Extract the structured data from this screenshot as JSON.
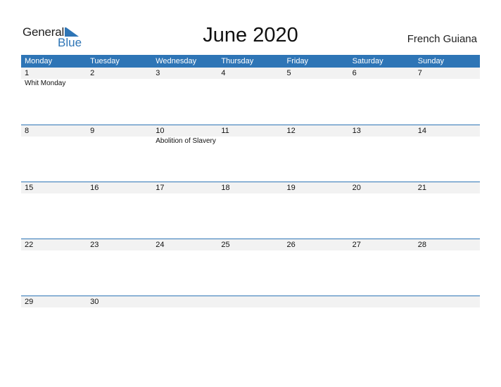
{
  "logo": {
    "line1": "General",
    "line2": "Blue",
    "accent_color": "#2e75b6"
  },
  "title": "June 2020",
  "country": "French Guiana",
  "weekdays": [
    "Monday",
    "Tuesday",
    "Wednesday",
    "Thursday",
    "Friday",
    "Saturday",
    "Sunday"
  ],
  "weeks": [
    {
      "days": [
        "1",
        "2",
        "3",
        "4",
        "5",
        "6",
        "7"
      ],
      "events": [
        "Whit Monday",
        "",
        "",
        "",
        "",
        "",
        ""
      ]
    },
    {
      "days": [
        "8",
        "9",
        "10",
        "11",
        "12",
        "13",
        "14"
      ],
      "events": [
        "",
        "",
        "Abolition of Slavery",
        "",
        "",
        "",
        ""
      ]
    },
    {
      "days": [
        "15",
        "16",
        "17",
        "18",
        "19",
        "20",
        "21"
      ],
      "events": [
        "",
        "",
        "",
        "",
        "",
        "",
        ""
      ]
    },
    {
      "days": [
        "22",
        "23",
        "24",
        "25",
        "26",
        "27",
        "28"
      ],
      "events": [
        "",
        "",
        "",
        "",
        "",
        "",
        ""
      ]
    },
    {
      "days": [
        "29",
        "30",
        "",
        "",
        "",
        "",
        ""
      ],
      "events": [
        "",
        "",
        "",
        "",
        "",
        "",
        ""
      ]
    }
  ]
}
